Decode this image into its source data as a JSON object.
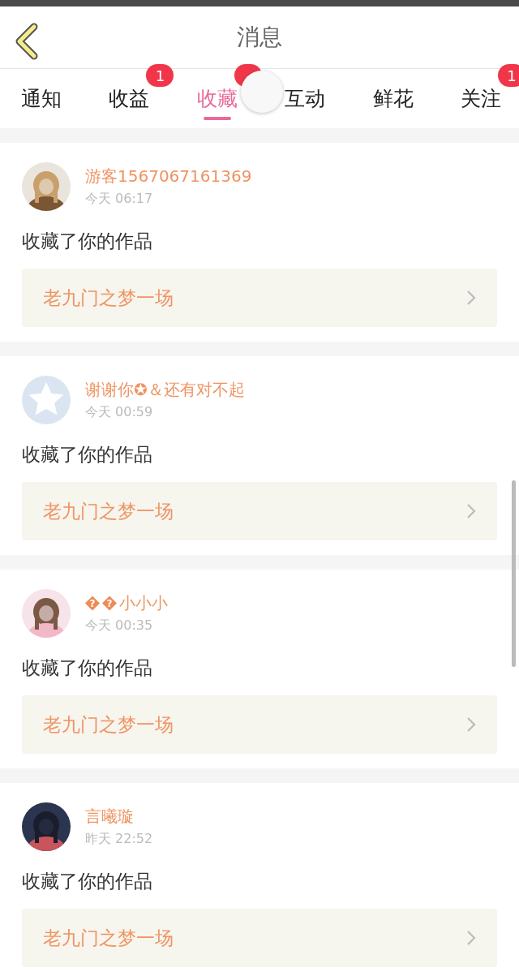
{
  "header": {
    "title": "消息"
  },
  "tabs": [
    {
      "label": "通知",
      "selected": false
    },
    {
      "label": "收益",
      "selected": false,
      "badge": "1"
    },
    {
      "label": "收藏",
      "selected": true,
      "badge_hidden": true
    },
    {
      "label": "互动",
      "selected": false
    },
    {
      "label": "鲜花",
      "selected": false
    },
    {
      "label": "关注",
      "selected": false,
      "badge": "1"
    }
  ],
  "touch_indicator": true,
  "messages": [
    {
      "name": "游客1567067161369",
      "time": "今天 06:17",
      "text": "收藏了你的作品",
      "work": "老九门之梦一场"
    },
    {
      "name": "谢谢你✪＆还有对不起",
      "time": "今天 00:59",
      "text": "收藏了你的作品",
      "work": "老九门之梦一场",
      "avatar": {
        "kind": "default"
      }
    },
    {
      "name_marks": [
        "?",
        "?"
      ],
      "name": "小小小",
      "time": "今天 00:35",
      "text": "收藏了你的作品",
      "work": "老九门之梦一场"
    },
    {
      "name": "言曦璇",
      "time": "昨天 22:52",
      "text": "收藏了你的作品",
      "work": "老九门之梦一场"
    }
  ]
}
